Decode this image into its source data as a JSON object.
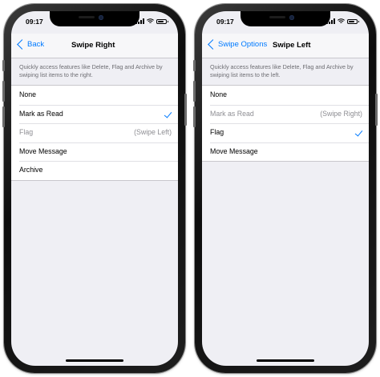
{
  "left_screen": {
    "time": "09:17",
    "back_label": "Back",
    "title": "Swipe Right",
    "description": "Quickly access features like Delete, Flag and Archive by swiping list items to the right.",
    "rows": [
      {
        "label": "None",
        "detail": "",
        "checked": false,
        "disabled": false
      },
      {
        "label": "Mark as Read",
        "detail": "",
        "checked": true,
        "disabled": false
      },
      {
        "label": "Flag",
        "detail": "(Swipe Left)",
        "checked": false,
        "disabled": true
      },
      {
        "label": "Move Message",
        "detail": "",
        "checked": false,
        "disabled": false
      },
      {
        "label": "Archive",
        "detail": "",
        "checked": false,
        "disabled": false
      }
    ]
  },
  "right_screen": {
    "time": "09:17",
    "back_label": "Swipe Options",
    "title": "Swipe Left",
    "description": "Quickly access features like Delete, Flag and Archive by swiping list items to the left.",
    "rows": [
      {
        "label": "None",
        "detail": "",
        "checked": false,
        "disabled": false
      },
      {
        "label": "Mark as Read",
        "detail": "(Swipe Right)",
        "checked": false,
        "disabled": true
      },
      {
        "label": "Flag",
        "detail": "",
        "checked": true,
        "disabled": false
      },
      {
        "label": "Move Message",
        "detail": "",
        "checked": false,
        "disabled": false
      }
    ]
  },
  "colors": {
    "accent": "#007aff",
    "background": "#efeff4",
    "secondary_text": "#8e8e93",
    "separator": "#c8c7cc"
  },
  "icons": [
    "signal-icon",
    "wifi-icon",
    "battery-icon",
    "chevron-left-icon",
    "checkmark-icon"
  ]
}
